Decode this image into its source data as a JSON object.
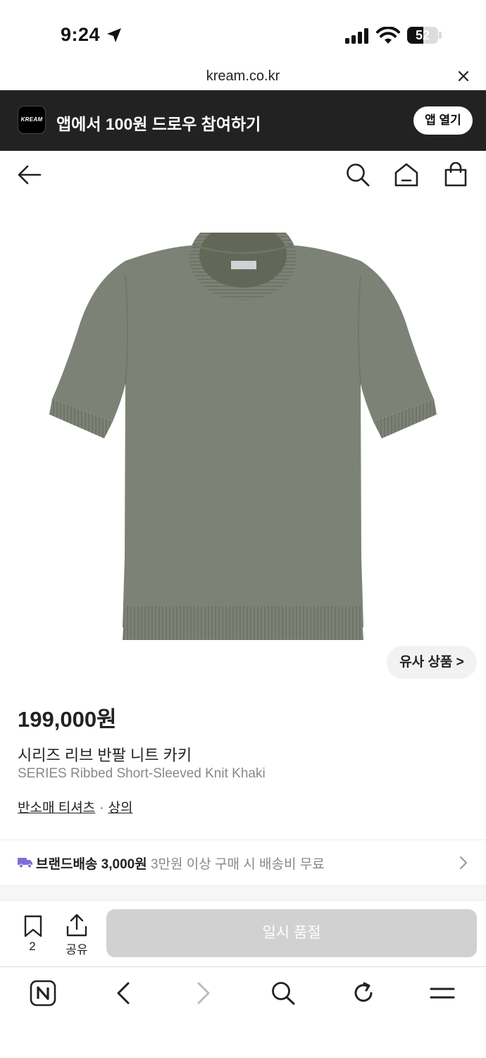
{
  "status": {
    "time": "9:24",
    "battery": "52",
    "battery_level": 0.52
  },
  "browser": {
    "url": "kream.co.kr"
  },
  "banner": {
    "logo_text": "KREAM",
    "text": "앱에서 100원 드로우 참여하기",
    "open_button": "앱 열기"
  },
  "product": {
    "similar_button": "유사 상품 >",
    "price": "199,000원",
    "name_ko": "시리즈 리브 반팔 니트 카키",
    "name_en": "SERIES Ribbed Short-Sleeved Knit Khaki",
    "category_1": "반소매 티셔츠",
    "category_sep": "·",
    "category_2": "상의",
    "image_color": "#7d8276"
  },
  "shipping": {
    "label": "브랜드배송 3,000원",
    "note": "3만원 이상 구매 시 배송비 무료"
  },
  "actions": {
    "bookmark_count": "2",
    "share_label": "공유",
    "soldout_label": "일시 품절"
  },
  "colors": {
    "banner_bg": "#222222",
    "disabled_button": "#d1d1d1",
    "truck": "#7b6fd6"
  },
  "icons": [
    "location-arrow-icon",
    "signal-icon",
    "wifi-icon",
    "battery-icon",
    "close-icon",
    "back-arrow-icon",
    "search-icon",
    "home-icon",
    "shopping-bag-icon",
    "truck-icon",
    "chevron-right-icon",
    "bookmark-icon",
    "share-icon",
    "naver-icon",
    "browser-back-icon",
    "browser-forward-icon",
    "browser-search-icon",
    "refresh-icon",
    "menu-icon"
  ]
}
